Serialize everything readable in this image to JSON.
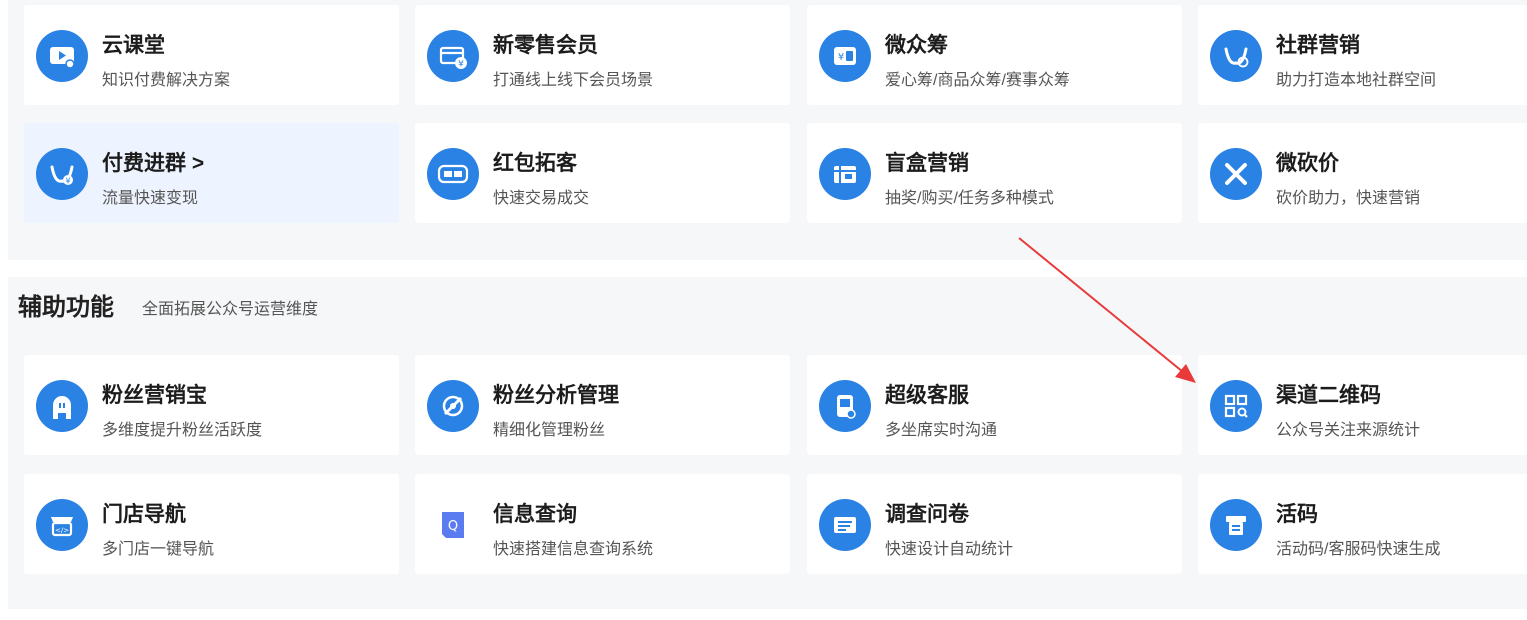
{
  "top_cards": [
    {
      "title": "云课堂",
      "desc": "知识付费解决方案",
      "icon": "tv-play-icon"
    },
    {
      "title": "新零售会员",
      "desc": "打通线上线下会员场景",
      "icon": "member-card-icon"
    },
    {
      "title": "微众筹",
      "desc": "爱心筹/商品众筹/赛事众筹",
      "icon": "crowdfunding-icon"
    },
    {
      "title": "社群营销",
      "desc": "助力打造本地社群空间",
      "icon": "community-icon"
    },
    {
      "title": "付费进群 >",
      "desc": "流量快速变现",
      "icon": "paid-group-icon"
    },
    {
      "title": "红包拓客",
      "desc": "快速交易成交",
      "icon": "red-packet-icon"
    },
    {
      "title": "盲盒营销",
      "desc": "抽奖/购买/任务多种模式",
      "icon": "blind-box-icon"
    },
    {
      "title": "微砍价",
      "desc": "砍价助力，快速营销",
      "icon": "bargain-icon"
    }
  ],
  "aux": {
    "title": "辅助功能",
    "subtitle": "全面拓展公众号运营维度",
    "cards": [
      {
        "title": "粉丝营销宝",
        "desc": "多维度提升粉丝活跃度",
        "icon": "fan-marketing-icon"
      },
      {
        "title": "粉丝分析管理",
        "desc": "精细化管理粉丝",
        "icon": "fan-analysis-icon"
      },
      {
        "title": "超级客服",
        "desc": "多坐席实时沟通",
        "icon": "customer-service-icon"
      },
      {
        "title": "渠道二维码",
        "desc": "公众号关注来源统计",
        "icon": "qr-code-icon"
      },
      {
        "title": "门店导航",
        "desc": "多门店一键导航",
        "icon": "store-nav-icon"
      },
      {
        "title": "信息查询",
        "desc": "快速搭建信息查询系统",
        "icon": "info-query-icon"
      },
      {
        "title": "调查问卷",
        "desc": "快速设计自动统计",
        "icon": "survey-icon"
      },
      {
        "title": "活码",
        "desc": "活动码/客服码快速生成",
        "icon": "live-code-icon"
      }
    ]
  },
  "colors": {
    "icon_blue": "#2a82e4",
    "query_icon": "#5b7cf0",
    "arrow": "#e83a3a",
    "active_card_bg": "#eef4ff"
  }
}
